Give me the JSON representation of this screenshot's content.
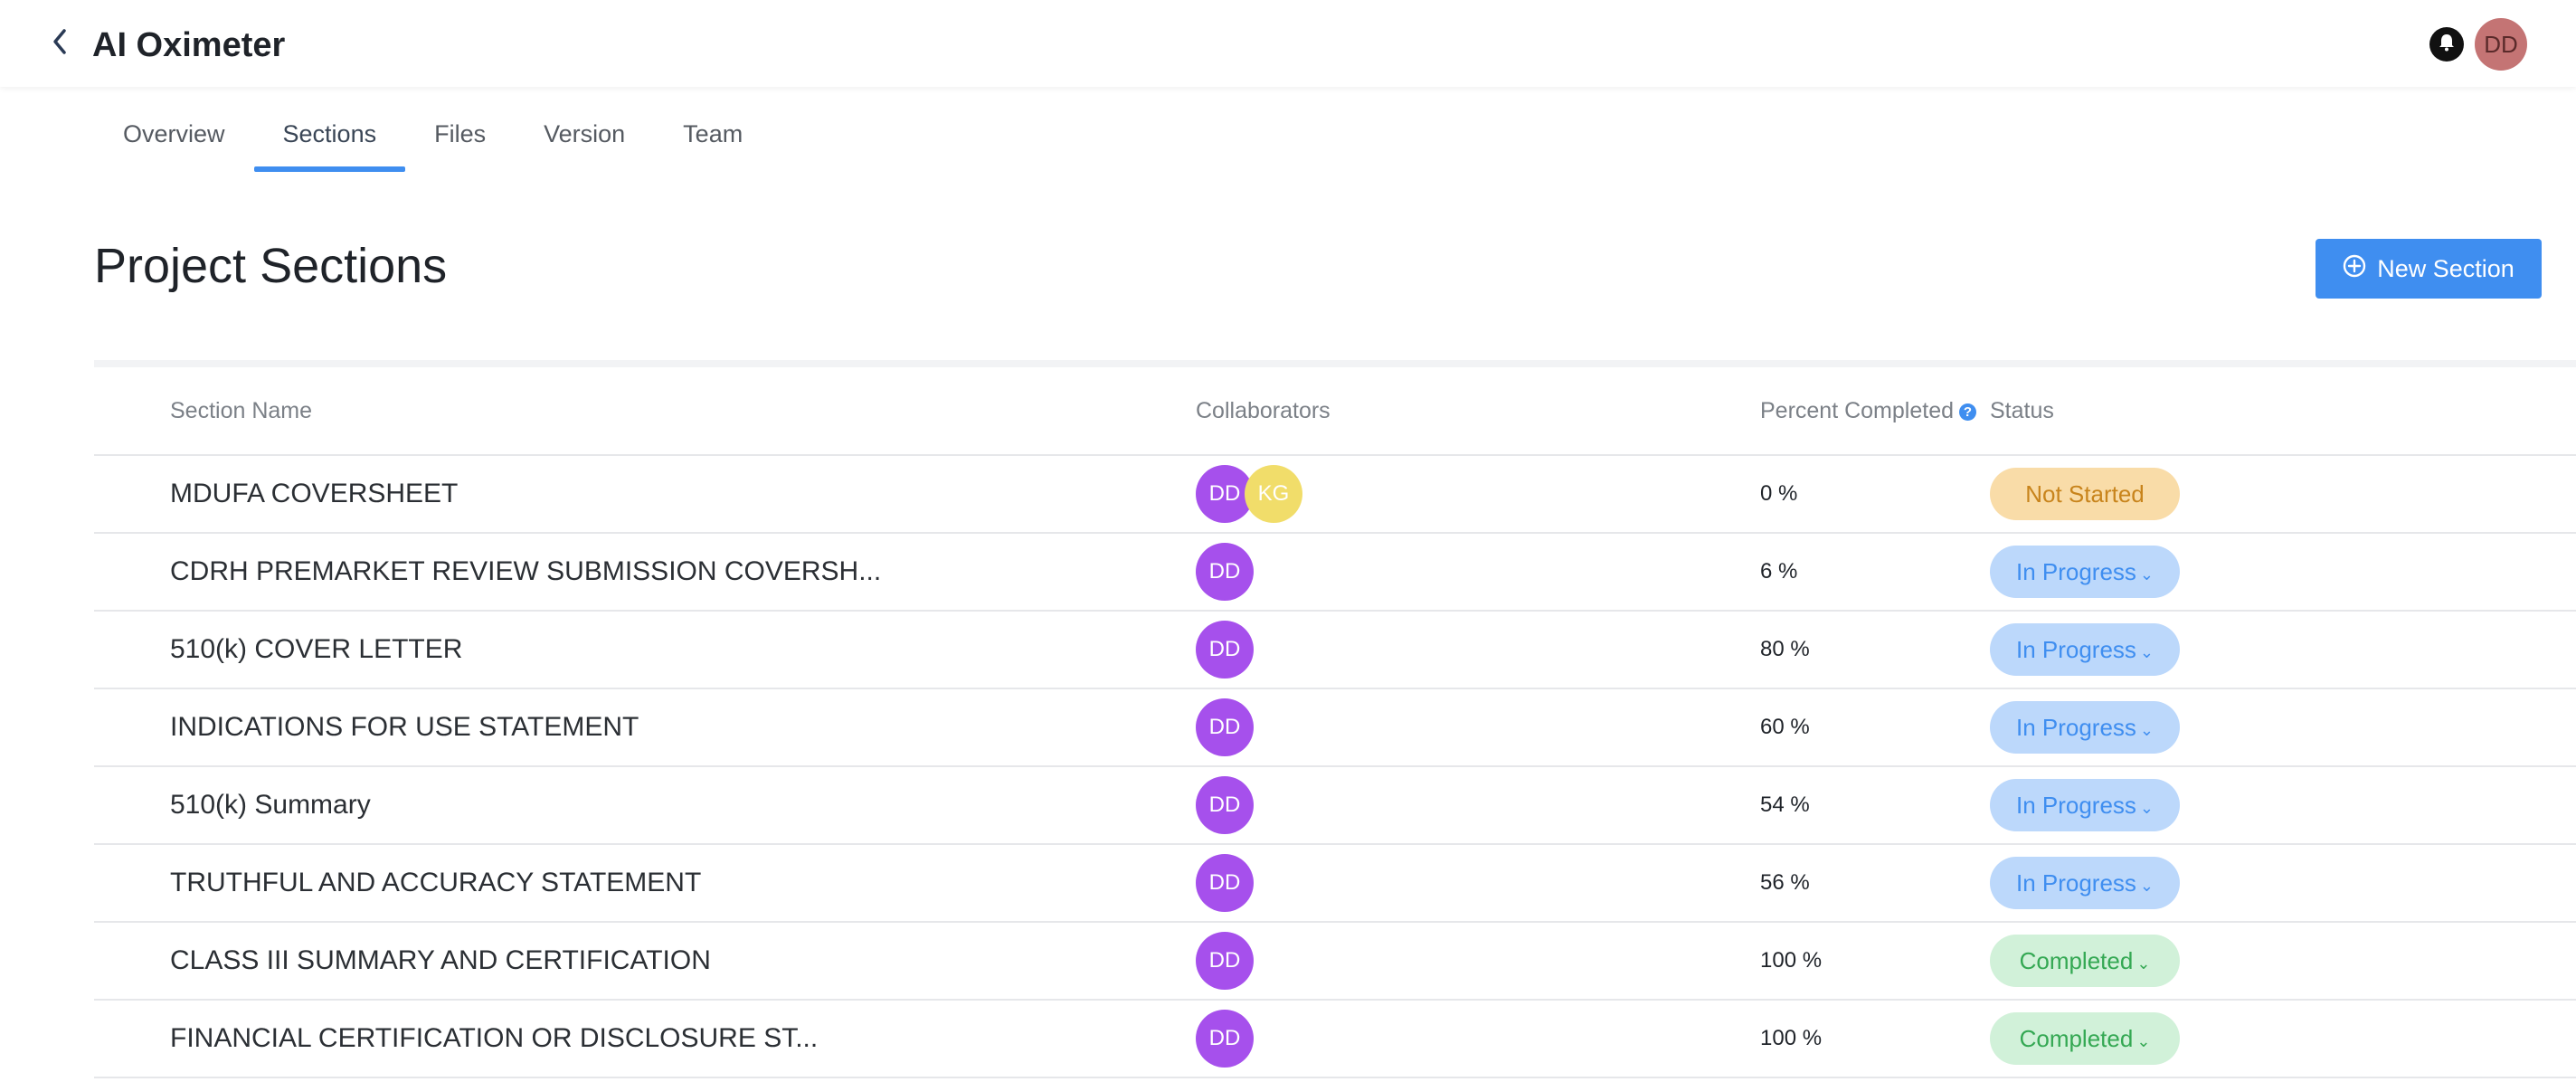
{
  "header": {
    "title": "AI Oximeter",
    "back_icon": "chevron-left-icon",
    "bell_icon": "bell-icon",
    "user_initials": "DD"
  },
  "tabs": [
    {
      "label": "Overview",
      "active": false
    },
    {
      "label": "Sections",
      "active": true
    },
    {
      "label": "Files",
      "active": false
    },
    {
      "label": "Version",
      "active": false
    },
    {
      "label": "Team",
      "active": false
    }
  ],
  "page": {
    "title": "Project Sections",
    "new_section_label": "New Section",
    "new_section_icon": "plus-circle-icon"
  },
  "table": {
    "headers": {
      "name": "Section Name",
      "collaborators": "Collaborators",
      "percent": "Percent Completed",
      "status": "Status"
    },
    "rows": [
      {
        "name": "MDUFA COVERSHEET",
        "collaborators": [
          "DD",
          "KG"
        ],
        "percent": "0 %",
        "status": "Not Started"
      },
      {
        "name": "CDRH PREMARKET REVIEW SUBMISSION COVERSH...",
        "collaborators": [
          "DD"
        ],
        "percent": "6 %",
        "status": "In Progress"
      },
      {
        "name": "510(k) COVER LETTER",
        "collaborators": [
          "DD"
        ],
        "percent": "80 %",
        "status": "In Progress"
      },
      {
        "name": "INDICATIONS FOR USE STATEMENT",
        "collaborators": [
          "DD"
        ],
        "percent": "60 %",
        "status": "In Progress"
      },
      {
        "name": "510(k) Summary",
        "collaborators": [
          "DD"
        ],
        "percent": "54 %",
        "status": "In Progress"
      },
      {
        "name": "TRUTHFUL AND ACCURACY STATEMENT",
        "collaborators": [
          "DD"
        ],
        "percent": "56 %",
        "status": "In Progress"
      },
      {
        "name": "CLASS III SUMMARY AND CERTIFICATION",
        "collaborators": [
          "DD"
        ],
        "percent": "100 %",
        "status": "Completed"
      },
      {
        "name": "FINANCIAL CERTIFICATION OR DISCLOSURE ST...",
        "collaborators": [
          "DD"
        ],
        "percent": "100 %",
        "status": "Completed"
      }
    ]
  },
  "colors": {
    "accent": "#3f8ef0",
    "not_started_bg": "#f9dca8",
    "not_started_text": "#c8841c",
    "in_progress_bg": "#bcd8fb",
    "in_progress_text": "#3f8ef0",
    "completed_bg": "#d1f1d9",
    "completed_text": "#34a853",
    "avatar_purple": "#a650ec",
    "avatar_yellow": "#f1dd6a",
    "user_avatar": "#c47474"
  }
}
